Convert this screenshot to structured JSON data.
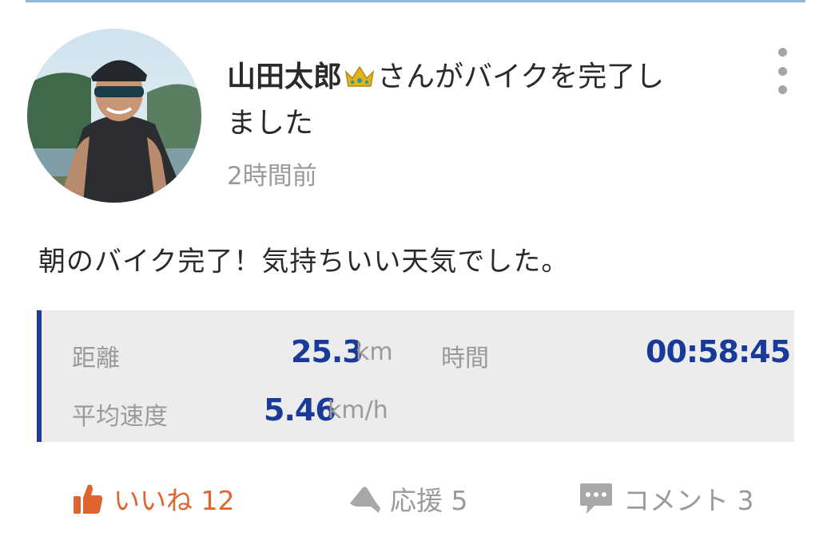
{
  "post": {
    "user_name": "山田太郎",
    "action_text": "さんがバイクを完了し",
    "action_text_line2": "ました",
    "time_ago": "2時間前",
    "message": "朝のバイク完了！気持ちいい天気でした。"
  },
  "stats": {
    "distance_label": "距離",
    "distance_value": "25.3",
    "distance_unit": "km",
    "time_label": "時間",
    "time_value": "00:58:45",
    "speed_label": "平均速度",
    "speed_value": "5.46",
    "speed_unit": "km/h"
  },
  "actions": {
    "like_label": "いいね 12",
    "cheer_label": "応援 5",
    "comment_label": "コメント 3"
  },
  "icons": {
    "crown": "crown-icon",
    "more": "more-vertical-icon",
    "like": "thumbs-up-icon",
    "cheer": "megaphone-icon",
    "comment": "speech-bubble-icon"
  },
  "colors": {
    "accent_blue": "#1e3a9a",
    "like_orange": "#e0642e",
    "muted_gray": "#9a9a9a",
    "panel_bg": "#ececec"
  }
}
